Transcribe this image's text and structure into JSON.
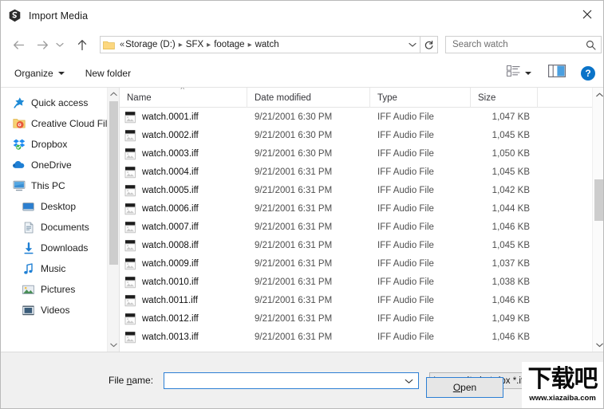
{
  "window": {
    "title": "Import Media",
    "app_icon": "adobe-media-icon",
    "close_label": "✕"
  },
  "navigation": {
    "back_icon": "arrow-left-icon",
    "forward_icon": "arrow-right-icon",
    "recent_icon": "chevron-down-icon",
    "up_icon": "arrow-up-icon",
    "refresh_icon": "refresh-icon",
    "folder_icon": "folder-icon",
    "breadcrumb_prefix": "«",
    "breadcrumbs": [
      "Storage (D:)",
      "SFX",
      "footage",
      "watch"
    ],
    "dropdown_icon": "chevron-down-icon"
  },
  "search": {
    "placeholder": "Search watch",
    "value": "",
    "icon": "search-icon"
  },
  "toolbar": {
    "organize_label": "Organize",
    "new_folder_label": "New folder",
    "view_options_icon": "view-list-icon",
    "view_options_caret": "chevron-down-icon",
    "preview_pane_icon": "preview-pane-icon",
    "help_label": "?",
    "help_icon": "help-icon"
  },
  "sidebar": {
    "items": [
      {
        "label": "Quick access",
        "icon": "star-pin-icon",
        "indent": false
      },
      {
        "label": "Creative Cloud Fil",
        "icon": "creative-cloud-folder-icon",
        "indent": false
      },
      {
        "label": "Dropbox",
        "icon": "dropbox-icon",
        "indent": false
      },
      {
        "label": "OneDrive",
        "icon": "onedrive-cloud-icon",
        "indent": false
      },
      {
        "label": "This PC",
        "icon": "this-pc-icon",
        "indent": false
      },
      {
        "label": "Desktop",
        "icon": "desktop-icon",
        "indent": true
      },
      {
        "label": "Documents",
        "icon": "documents-icon",
        "indent": true
      },
      {
        "label": "Downloads",
        "icon": "downloads-icon",
        "indent": true
      },
      {
        "label": "Music",
        "icon": "music-note-icon",
        "indent": true
      },
      {
        "label": "Pictures",
        "icon": "pictures-icon",
        "indent": true
      },
      {
        "label": "Videos",
        "icon": "videos-icon",
        "indent": true
      }
    ],
    "scroll_up_icon": "chevron-up-icon",
    "scroll_down_icon": "chevron-down-icon"
  },
  "file_list": {
    "columns": [
      "Name",
      "Date modified",
      "Type",
      "Size"
    ],
    "sort_column": "Name",
    "sort_caret": "˄",
    "scroll_up_icon": "chevron-up-icon",
    "scroll_down_icon": "chevron-down-icon",
    "rows": [
      {
        "name": "watch.0001.iff",
        "date": "9/21/2001 6:30 PM",
        "type": "IFF Audio File",
        "size": "1,047 KB"
      },
      {
        "name": "watch.0002.iff",
        "date": "9/21/2001 6:30 PM",
        "type": "IFF Audio File",
        "size": "1,045 KB"
      },
      {
        "name": "watch.0003.iff",
        "date": "9/21/2001 6:30 PM",
        "type": "IFF Audio File",
        "size": "1,050 KB"
      },
      {
        "name": "watch.0004.iff",
        "date": "9/21/2001 6:31 PM",
        "type": "IFF Audio File",
        "size": "1,045 KB"
      },
      {
        "name": "watch.0005.iff",
        "date": "9/21/2001 6:31 PM",
        "type": "IFF Audio File",
        "size": "1,042 KB"
      },
      {
        "name": "watch.0006.iff",
        "date": "9/21/2001 6:31 PM",
        "type": "IFF Audio File",
        "size": "1,044 KB"
      },
      {
        "name": "watch.0007.iff",
        "date": "9/21/2001 6:31 PM",
        "type": "IFF Audio File",
        "size": "1,046 KB"
      },
      {
        "name": "watch.0008.iff",
        "date": "9/21/2001 6:31 PM",
        "type": "IFF Audio File",
        "size": "1,045 KB"
      },
      {
        "name": "watch.0009.iff",
        "date": "9/21/2001 6:31 PM",
        "type": "IFF Audio File",
        "size": "1,037 KB"
      },
      {
        "name": "watch.0010.iff",
        "date": "9/21/2001 6:31 PM",
        "type": "IFF Audio File",
        "size": "1,038 KB"
      },
      {
        "name": "watch.0011.iff",
        "date": "9/21/2001 6:31 PM",
        "type": "IFF Audio File",
        "size": "1,046 KB"
      },
      {
        "name": "watch.0012.iff",
        "date": "9/21/2001 6:31 PM",
        "type": "IFF Audio File",
        "size": "1,049 KB"
      },
      {
        "name": "watch.0013.iff",
        "date": "9/21/2001 6:31 PM",
        "type": "IFF Audio File",
        "size": "1,046 KB"
      }
    ]
  },
  "footer": {
    "file_name_label_pre": "File ",
    "file_name_label_accel": "n",
    "file_name_label_post": "ame:",
    "file_name_value": "",
    "file_name_placeholder": "",
    "file_name_caret_icon": "chevron-down-icon",
    "filter_value": "Images (*.cin *.dpx *.iff *.jpg *.j",
    "filter_caret_icon": "chevron-down-icon",
    "open_label_pre": "",
    "open_label_accel": "O",
    "open_label_post": "pen"
  },
  "watermark": {
    "text_cn": "下载吧",
    "url": "www.xiazaiba.com"
  },
  "colors": {
    "accent_blue": "#2c7fd4",
    "help_blue": "#0a73c8",
    "footer_bg": "#f0f0f0",
    "scroll_thumb": "#cdcdcd"
  }
}
